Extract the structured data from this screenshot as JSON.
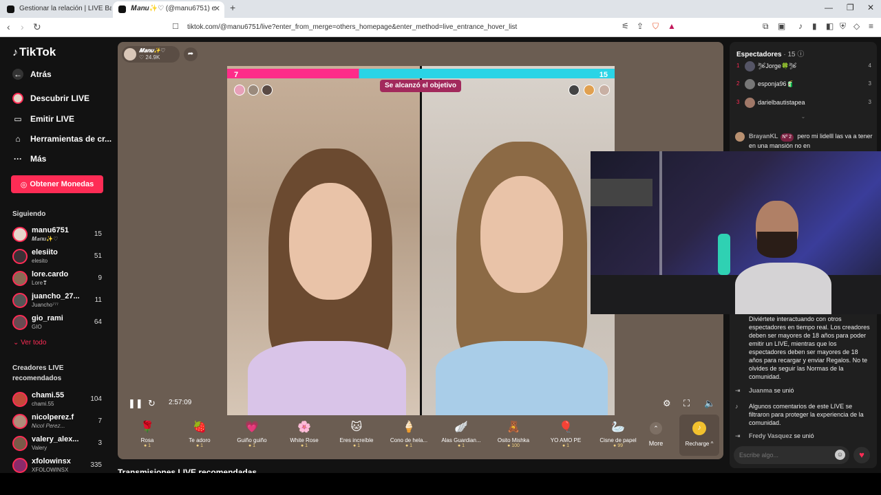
{
  "browser": {
    "tab1_title": "Gestionar la relación | LIVE Backstage",
    "tab2_title": "𝑴𝒂𝒏𝒖✨♡ (@manu6751) e",
    "url": "tiktok.com/@manu6751/live?enter_from_merge=others_homepage&enter_method=live_entrance_hover_list"
  },
  "sidebar": {
    "logo": "TikTok",
    "nav": [
      {
        "label": "Atrás"
      },
      {
        "label": "Descubrir LIVE"
      },
      {
        "label": "Emitir LIVE"
      },
      {
        "label": "Herramientas de cr..."
      },
      {
        "label": "Más"
      }
    ],
    "coins_button": "Obtener Monedas",
    "following_title": "Siguiendo",
    "following": [
      {
        "username": "manu6751",
        "sub": "𝑴𝒂𝒏𝒖✨♡",
        "count": "15"
      },
      {
        "username": "elesiito",
        "sub": "elesito",
        "count": "51"
      },
      {
        "username": "lore.cardo",
        "sub": "Lore❣",
        "count": "9"
      },
      {
        "username": "juancho_27...",
        "sub": "Juancho⁷⁷⁷",
        "count": "11"
      },
      {
        "username": "gio_rami",
        "sub": "GIO",
        "count": "64"
      }
    ],
    "see_all": "Ver todo",
    "recommended_title": "Creadores LIVE recomendados",
    "recommended": [
      {
        "username": "chami.55",
        "sub": "chami.55",
        "count": "104"
      },
      {
        "username": "nicolperez.f",
        "sub": "𝑁𝑖𝑐𝑜𝑙 𝑃𝑒𝑟𝑒𝑧...",
        "count": "7"
      },
      {
        "username": "valery_alex...",
        "sub": "Valery",
        "count": "3"
      },
      {
        "username": "xfolowinsx",
        "sub": "XFOLOWINSX",
        "count": "335"
      }
    ]
  },
  "player": {
    "host_name": "𝑴𝒂𝒏𝒖✨♡",
    "host_likes": "24.9K",
    "score_left": "7",
    "score_right": "15",
    "goal_text": "Se alcanzó el objetivo",
    "time": "2:57:09",
    "gifts": [
      {
        "name": "Rosa",
        "price": "1",
        "icon": "🌹"
      },
      {
        "name": "Te adoro",
        "price": "1",
        "icon": "🍓"
      },
      {
        "name": "Guiño guiño",
        "price": "1",
        "icon": "💗"
      },
      {
        "name": "White Rose",
        "price": "1",
        "icon": "🌸"
      },
      {
        "name": "Eres increíble",
        "price": "1",
        "icon": "🐱"
      },
      {
        "name": "Cono de hela...",
        "price": "1",
        "icon": "🍦"
      },
      {
        "name": "Alas Guardian...",
        "price": "1",
        "icon": "🪽"
      },
      {
        "name": "Osito Mishka",
        "price": "100",
        "icon": "🧸"
      },
      {
        "name": "YO AMO PE",
        "price": "1",
        "icon": "🎈"
      },
      {
        "name": "Cisne de papel",
        "price": "99",
        "icon": "🦢"
      }
    ],
    "more_label": "More",
    "recharge_label": "Recharge ^",
    "recommended_streams": "Transmisiones LIVE recomendadas"
  },
  "chat": {
    "viewers_title": "Espectadores",
    "viewers_count": "· 15",
    "viewers": [
      {
        "rank": "1",
        "name": "🛩Jorge🍀🛩",
        "count": "4"
      },
      {
        "rank": "2",
        "name": "esponja96🧃",
        "count": "3"
      },
      {
        "rank": "3",
        "name": "darielbautistapea",
        "count": "3"
      }
    ],
    "comment1_user": "BrayanKL",
    "comment1_badge": "Nº 2",
    "comment1_text": "pero mi lidelll las va a tener en una mansión no en",
    "welcome_text": "Diviértete interactuando con otros espectadores en tiempo real. Los creadores deben ser mayores de 18 años para poder emitir un LIVE, mientras que los espectadores deben ser mayores de 18 años para recargar y enviar Regalos. No te olvides de seguir las Normas de la comunidad.",
    "join1_user": "Juanma",
    "join_text": "se unió",
    "filter_text": "Algunos comentarios de este LIVE se filtraron para proteger la experiencia de la comunidad.",
    "join2_user": "Fredy Vasquez",
    "input_placeholder": "Escribe algo..."
  }
}
